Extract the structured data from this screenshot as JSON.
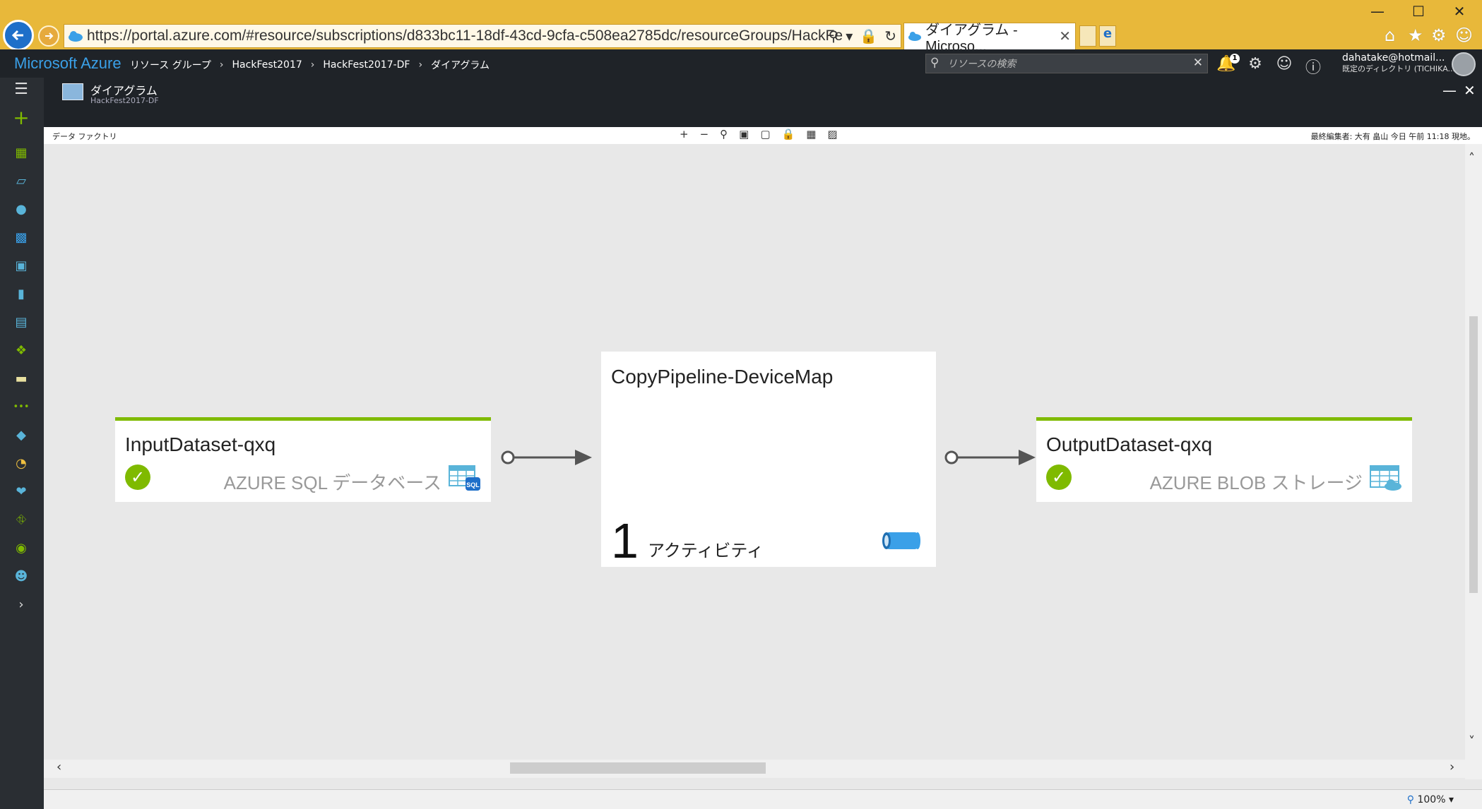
{
  "browser": {
    "url": "https://portal.azure.com/#resource/subscriptions/d833bc11-18df-43cd-9cfa-c508ea2785dc/resourceGroups/HackFest2(",
    "active_tab_title": "ダイアグラム - Microso...",
    "accent_color": "#e8b83a"
  },
  "azure": {
    "brand": "Microsoft Azure",
    "breadcrumbs": [
      "リソース グループ",
      "HackFest2017",
      "HackFest2017-DF",
      "ダイアグラム"
    ],
    "search_placeholder": "リソースの検索",
    "notification_count": "1",
    "user_email": "dahatake@hotmail...",
    "user_directory": "既定のディレクトリ (TICHIKA..."
  },
  "blade": {
    "title": "ダイアグラム",
    "subtitle": "HackFest2017-DF"
  },
  "canvas_toolbar": {
    "label": "データ ファクトリ",
    "status": "最終編集者: 大有 畠山 今日 午前 11:18 現地。"
  },
  "diagram": {
    "input_dataset": {
      "title": "InputDataset-qxq",
      "type_label": "AZURE SQL データベース",
      "status": "ok"
    },
    "pipeline": {
      "title": "CopyPipeline-DeviceMap",
      "activity_count": "1",
      "activity_label": "アクティビティ"
    },
    "output_dataset": {
      "title": "OutputDataset-qxq",
      "type_label": "AZURE BLOB ストレージ",
      "status": "ok"
    },
    "status_color": "#7fba00"
  },
  "statusbar": {
    "zoom": "100%"
  }
}
